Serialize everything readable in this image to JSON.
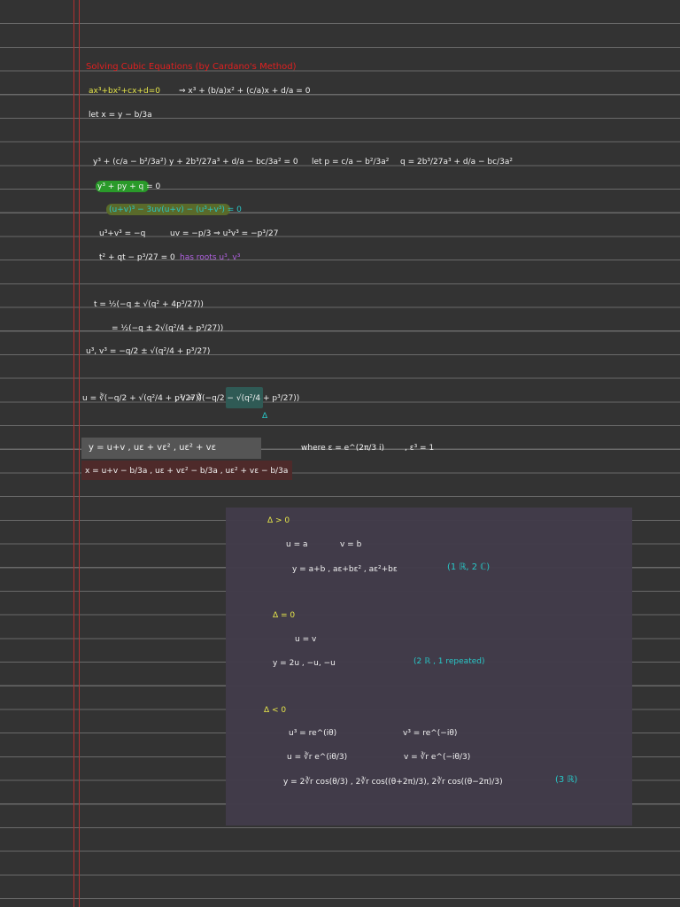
{
  "title": "Solving Cubic Equations (by Cardano's Method)",
  "lines": {
    "general": "ax³+bx²+cx+d=0",
    "normalized": "⇒ x³ + (b/a)x² + (c/a)x + d/a = 0",
    "substitution": "let x = y − b/3a",
    "depressed_full": "y³ + (c/a − b²/3a²) y + 2b³/27a³ + d/a − bc/3a² = 0",
    "p_def": "let p = c/a − b²/3a²",
    "q_def": "q = 2b³/27a³ + d/a − bc/3a²",
    "depressed": "y³ + py + q = 0",
    "identity": "(u+v)³ − 3uv(u+v) − (u³+v³) = 0",
    "sum_cubes": "u³+v³ = −q",
    "uv": "uv = −p/3 ⇒ u³v³ = −p³/27",
    "quadratic": "t² + qt − p³/27 = 0",
    "roots_note": "has roots u³, v³",
    "t_formula": "t = ½(−q ± √(q² + 4p³/27))",
    "t_formula2": "= ½(−q ± 2√(q²/4 + p³/27))",
    "u3v3": "u³, v³  = −q/2 ± √(q²/4 + p³/27)",
    "u_formula": "u = ∛(−q/2 + √(q²/4 + p³/27))",
    "v_formula": ", v = ∛(−q/2 − √(q²/4 + p³/27))",
    "delta_label": "Δ",
    "y_roots": "y = u+v ,   uε + vε² ,   uε² + vε",
    "where": "where  ε = e^(2π/3 i)",
    "eps_cube": ", ε³ = 1",
    "x_roots": "x = u+v − b/3a   ,  uε + vε² − b/3a  ,  uε² + vε − b/3a"
  },
  "cases": {
    "pos": {
      "heading": "Δ > 0",
      "u": "u = a",
      "v": "v = b",
      "roots": "y = a+b  ,  aε+bε² ,  aε²+bε",
      "note": "(1 ℝ, 2 ℂ)"
    },
    "zero": {
      "heading": "Δ = 0",
      "uv": "u = v",
      "roots": "y = 2u  ,  −u, −u",
      "note": "(2 ℝ , 1 repeated)"
    },
    "neg": {
      "heading": "Δ < 0",
      "u3": "u³ = re^(iθ)",
      "v3": "v³ = re^(−iθ)",
      "u": "u = ∛r e^(iθ/3)",
      "v": "v = ∛r e^(−iθ/3)",
      "roots": "y = 2∛r cos(θ/3) ,  2∛r cos((θ+2π)/3),    2∛r cos((θ−2π)/3)",
      "note": "(3 ℝ)"
    }
  },
  "colors": {
    "background": "#333333",
    "title": "#e02020",
    "highlight_green": "#2a9a2a",
    "highlight_olive": "#8a8a20",
    "highlight_purple": "#9a2a9a",
    "box": "#423b4a"
  }
}
